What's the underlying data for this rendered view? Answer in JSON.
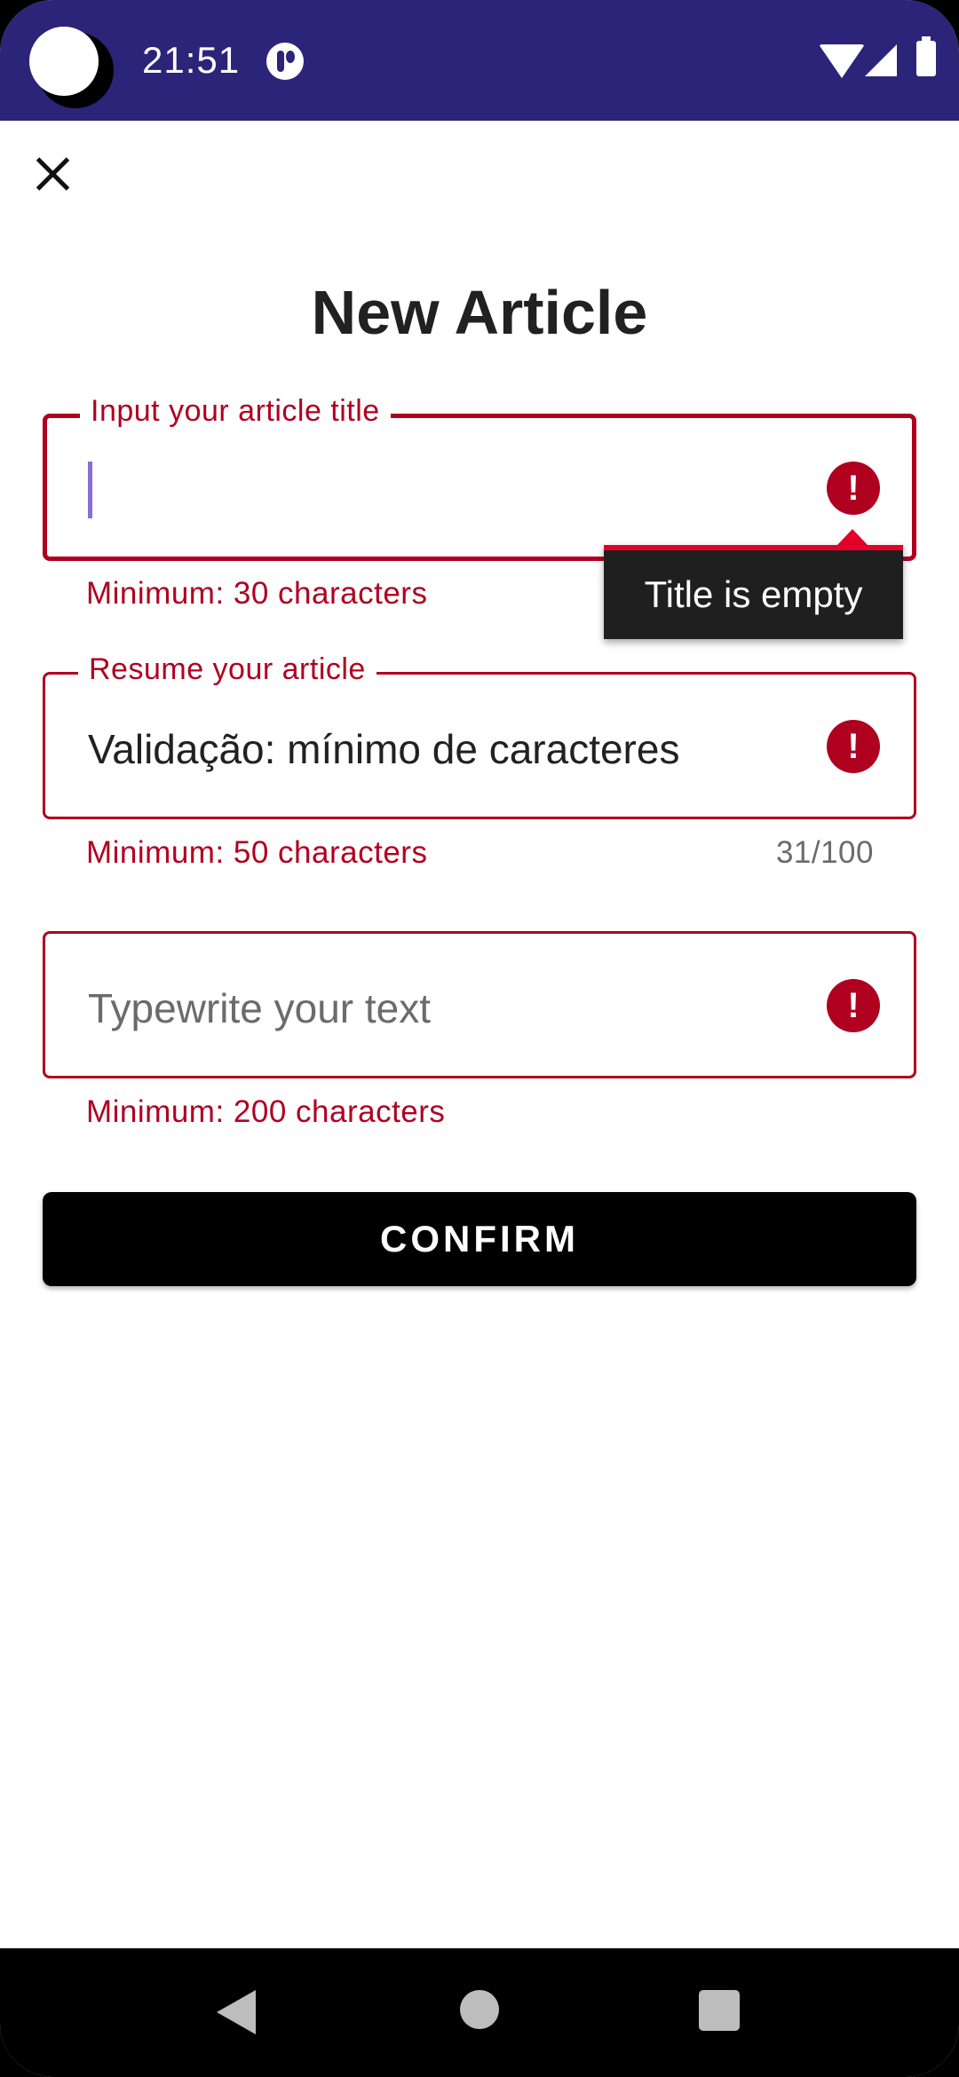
{
  "status_bar": {
    "time": "21:51",
    "icons": [
      "notification-icon",
      "wifi-icon",
      "signal-icon",
      "battery-icon"
    ]
  },
  "header": {
    "close_icon": "close-icon",
    "title": "New Article"
  },
  "form": {
    "title_field": {
      "label": "Input your article title",
      "value": "",
      "helper": "Minimum: 30 characters",
      "error_tooltip": "Title is empty"
    },
    "resume_field": {
      "label": "Resume your article",
      "value": "Validação: mínimo de caracteres",
      "helper": "Minimum: 50 characters",
      "counter": "31/100"
    },
    "text_field": {
      "placeholder": "Typewrite your text",
      "helper": "Minimum: 200 characters"
    },
    "error_icon_glyph": "!",
    "confirm_label": "CONFIRM"
  },
  "colors": {
    "status_bar": "#2c2479",
    "error": "#b00020",
    "button": "#000000",
    "tooltip_accent": "#e4002b"
  }
}
